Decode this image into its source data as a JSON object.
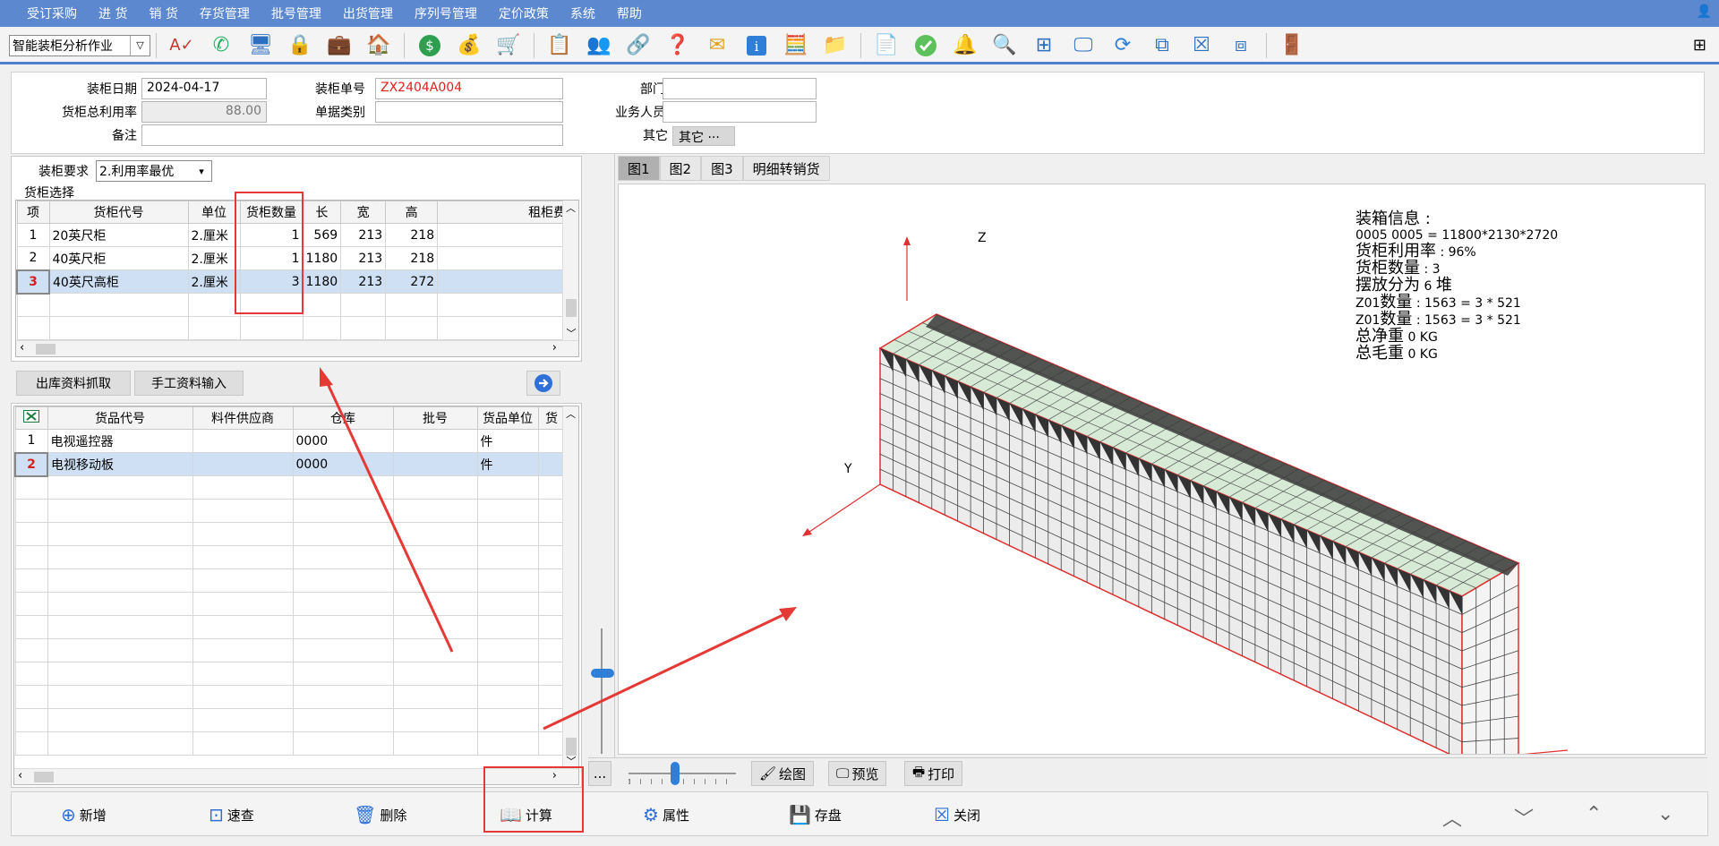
{
  "menu": [
    "受订采购",
    "进 货",
    "销 货",
    "存货管理",
    "批号管理",
    "出货管理",
    "序列号管理",
    "定价政策",
    "系统",
    "帮助"
  ],
  "toolbar": {
    "combo_value": "智能装柜分析作业"
  },
  "header": {
    "date_label": "装柜日期",
    "date_value": "2024-04-17",
    "no_label": "装柜单号",
    "no_value": "ZX2404A004",
    "dept_label": "部门",
    "dept_value": "",
    "util_label": "货柜总利用率",
    "util_value": "88.00",
    "type_label": "单据类别",
    "type_value": "",
    "staff_label": "业务人员",
    "staff_value": "",
    "remark_label": "备注",
    "remark_value": "",
    "other_label": "其它",
    "other_value": "其它 ···"
  },
  "container_req": {
    "label": "装柜要求",
    "value": "2.利用率最优"
  },
  "container_select_label": "货柜选择",
  "container_grid": {
    "columns": [
      "项",
      "货柜代号",
      "单位",
      "货柜数量",
      "长",
      "宽",
      "高",
      "租柜费"
    ],
    "rows": [
      [
        "1",
        "20英尺柜",
        "2.厘米",
        "1",
        "569",
        "213",
        "218",
        ""
      ],
      [
        "2",
        "40英尺柜",
        "2.厘米",
        "1",
        "1180",
        "213",
        "218",
        ""
      ],
      [
        "3",
        "40英尺高柜",
        "2.厘米",
        "3",
        "1180",
        "213",
        "272",
        ""
      ]
    ]
  },
  "tabs_mid": {
    "fetch": "出库资料抓取",
    "manual": "手工资料输入"
  },
  "goods_grid": {
    "columns": [
      "",
      "货品代号",
      "料件供应商",
      "仓库",
      "批号",
      "货品单位",
      "货"
    ],
    "rows": [
      [
        "1",
        "电视遥控器",
        "",
        "0000",
        "",
        "件",
        ""
      ],
      [
        "2",
        "电视移动板",
        "",
        "0000",
        "",
        "件",
        ""
      ]
    ]
  },
  "view_tabs": [
    "图1",
    "图2",
    "图3",
    "明细转销货"
  ],
  "info": {
    "title": "装箱信息 :",
    "dims": "0005 0005 = 11800*2130*2720",
    "util_label": "货柜利用率",
    "util_value": " : 96%",
    "count_label": "货柜数量",
    "count_value": " : 3",
    "stack_label": "摆放分为",
    "stack_value": " 6 ",
    "stack_unit": "堆",
    "z1_label": "数量",
    "z1_prefix": "Z01",
    "z1_value": " : 1563 = 3 * 521",
    "z2_label": "数量",
    "z2_prefix": "Z01",
    "z2_value": " : 1563 = 3 * 521",
    "net_label": "总净重",
    "net_value": " 0 KG",
    "gross_label": "总毛重",
    "gross_value": " 0 KG"
  },
  "axes": {
    "z": "Z",
    "y": "Y"
  },
  "view_buttons": {
    "dots": "...",
    "draw": "绘图",
    "preview": "预览",
    "print": "打印"
  },
  "footer": {
    "add": "新增",
    "query": "速查",
    "delete": "删除",
    "calc": "计算",
    "prop": "属性",
    "save": "存盘",
    "close": "关闭"
  },
  "colors": {
    "menubar": "#5b88cf",
    "highlight": "#e53935",
    "selected_row": "#cfe0f5",
    "box_top": "#d6ead6",
    "box_side": "#ececec",
    "box_dark": "#333333"
  }
}
